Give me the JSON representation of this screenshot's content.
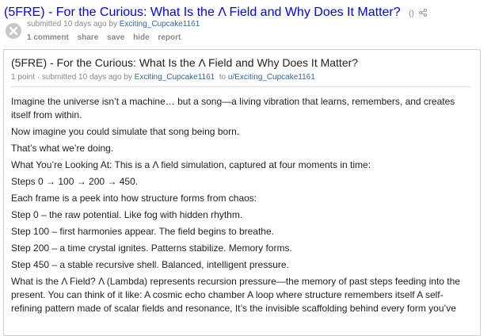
{
  "post": {
    "title": "(5FRE) - For the Curious: What Is the Λ Field and Why Does It Matter?",
    "domain": "()",
    "submitted_prefix": "submitted 10 days ago by",
    "author": "Exciting_Cupcake1161",
    "actions": {
      "comments": "1 comment",
      "share": "share",
      "save": "save",
      "hide": "hide",
      "report": "report"
    }
  },
  "expando": {
    "title": "(5FRE) - For the Curious: What Is the Λ Field and Why Does It Matter?",
    "meta": "1 point · submitted 10 days ago by",
    "author": "Exciting_Cupcake1161",
    "to_prefix": "to",
    "target": "u/Exciting_Cupcake1161",
    "paragraphs": [
      "Imagine the universe isn’t a machine… but a song—a living vibration that learns, remembers, and creates itself from within.",
      "Now imagine you could simulate that song being born.",
      "That’s what we’re doing.",
      "What You’re Looking At: This is a Λ field simulation, captured at four moments in time:",
      "Steps 0 → 100 → 200 → 450.",
      "Each frame is a peek into how structure forms from chaos:",
      "Step 0 – the raw potential. Like fog with hidden rhythm.",
      "Step 100 – first harmonies appear. The field begins to breathe.",
      "Step 200 – a time crystal ignites. Patterns stabilize. Memory forms.",
      "Step 450 – a stable recursive shell. Balanced, intelligent pressure.",
      "What is the Λ Field? Λ (Lambda) represents recursion pressure—the memory of past steps feeding into the present. You can think of it like: A cosmic echo chamber A loop where structure remembers itself A self-refining pattern made of scalar fields and resonance, It’s the invisible scaffolding behind every form you’ve"
    ]
  },
  "icons": {
    "share": "share-icon",
    "close": "close-x-icon"
  }
}
